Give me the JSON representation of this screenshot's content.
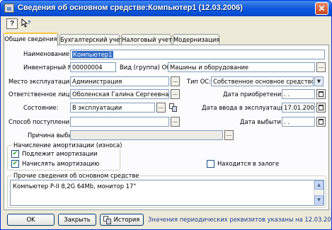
{
  "window": {
    "title": "Сведения об основном средстве:Компьютер1 (12.03.2006)",
    "close_glyph": "✕"
  },
  "toolbar": {
    "help_label": "?",
    "whats_this_icon": "pointer-question-icon"
  },
  "tabs": [
    {
      "label": "Общие сведения",
      "active": true
    },
    {
      "label": "Бухгалтерский учет",
      "active": false
    },
    {
      "label": "Налоговый учет",
      "active": false
    },
    {
      "label": "Модернизация",
      "active": false
    }
  ],
  "form": {
    "name_label": "Наименование:",
    "name_value": "Компьютер1",
    "inventory_label": "Инвентарный №:",
    "inventory_value": "00000004",
    "group_label": "Вид (группа) ОС:",
    "group_value": "Машины и оборудование",
    "location_label": "Место эксплуатации:",
    "location_value": "Администрация",
    "os_type_label": "Тип ОС:",
    "os_type_value": "Собственное основное средство",
    "responsible_label": "Ответственное лицо:",
    "responsible_value": "Оболенская Галина Сергеевна",
    "acquisition_date_label": "Дата приобретения:",
    "acquisition_date_value": ". .",
    "state_label": "Состояние:",
    "state_value": "В эксплуатации",
    "commission_date_label": "Дата ввода в эксплуатацию:",
    "commission_date_value": "17.01.2003",
    "receipt_method_label": "Способ поступления:",
    "receipt_method_value": "",
    "disposal_date_label": "Дата выбытия:",
    "disposal_date_value": ". .",
    "disposal_reason_label": "Причина выбытия:",
    "disposal_reason_value": "",
    "dots_label": "..."
  },
  "depreciation": {
    "group_title": "Начисление амортизации (износа)",
    "subject_label": "Подлежит амортизации",
    "subject_checked": true,
    "accrue_label": "Начислять амортизацию",
    "accrue_checked": true,
    "pledge_label": "Находится в залоге",
    "pledge_checked": false
  },
  "other_info": {
    "title": "Прочие сведения об основном средстве",
    "text": "Компьютер P-II 8,2G 64Mb, монитор 17\""
  },
  "buttons": {
    "ok": "OK",
    "close": "Закрыть",
    "history": "История"
  },
  "status": {
    "text": "Значения периодических реквизитов указаны на 12.03.2006"
  },
  "colors": {
    "titlebar": "#0a57e0",
    "selection": "#316ac5",
    "active_tab_accent": "#ffc83c",
    "status_text": "#1e3c96"
  }
}
